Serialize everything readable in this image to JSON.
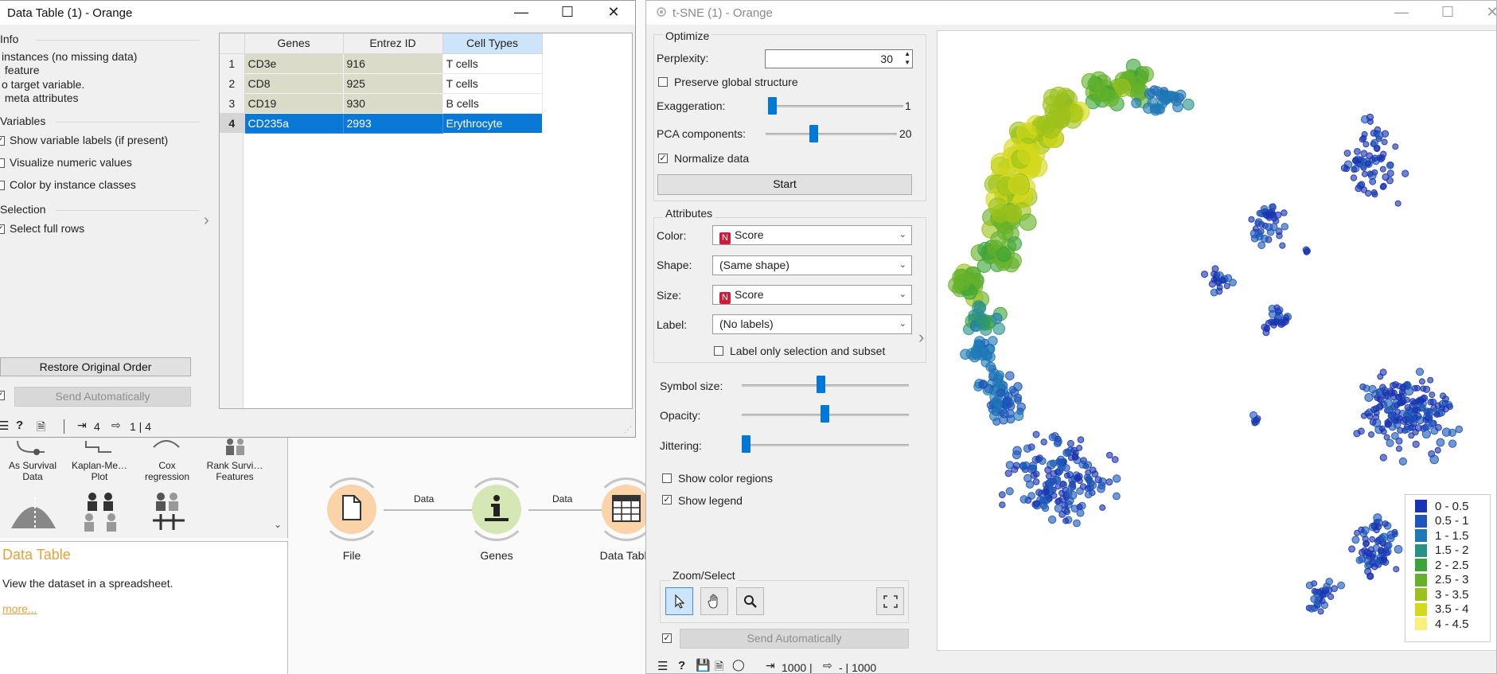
{
  "data_table_window": {
    "title": "Data Table (1) - Orange",
    "info": {
      "heading": "Info",
      "lines": [
        "instances (no missing data)",
        " feature",
        "o target variable.",
        " meta attributes"
      ]
    },
    "variables": {
      "heading": "Variables",
      "show_labels": "Show variable labels (if present)",
      "visualize": "Visualize numeric values",
      "color_by": "Color by instance classes"
    },
    "selection": {
      "heading": "Selection",
      "select_rows": "Select full rows"
    },
    "restore_button": "Restore Original Order",
    "send_button": "Send Automatically",
    "status": {
      "in_count": "4",
      "out_count": "1 | 4"
    },
    "table": {
      "headers": [
        "Genes",
        "Entrez ID",
        "Cell Types"
      ],
      "rows": [
        {
          "num": "1",
          "cells": [
            "CD3e",
            "916",
            "T cells"
          ]
        },
        {
          "num": "2",
          "cells": [
            "CD8",
            "925",
            "T cells"
          ]
        },
        {
          "num": "3",
          "cells": [
            "CD19",
            "930",
            "B cells"
          ]
        },
        {
          "num": "4",
          "cells": [
            "CD235a",
            "2993",
            "Erythrocyte"
          ]
        }
      ],
      "selected_row": 4
    }
  },
  "canvas": {
    "toolbox": [
      {
        "label": "As Survival\nData",
        "icon": "survival-data-icon"
      },
      {
        "label": "Kaplan-Me…\nPlot",
        "icon": "kaplan-meier-icon"
      },
      {
        "label": "Cox\nregression",
        "icon": "cox-regression-icon"
      },
      {
        "label": "Rank Survi…\nFeatures",
        "icon": "rank-features-icon"
      }
    ],
    "help": {
      "title": "Data Table",
      "description": "View the dataset in a spreadsheet.",
      "more": "more..."
    },
    "nodes": [
      {
        "label": "File",
        "icon": "file-icon",
        "color": "#fbd3a8"
      },
      {
        "label": "Genes",
        "icon": "info-icon",
        "color": "#d6e7b6"
      },
      {
        "label": "Data Table",
        "icon": "table-icon",
        "color": "#fbd3a8"
      }
    ],
    "links": [
      "Data",
      "Data"
    ]
  },
  "tsne_window": {
    "title": "t-SNE (1) - Orange",
    "optimize": {
      "heading": "Optimize",
      "perplexity_label": "Perplexity:",
      "perplexity_value": "30",
      "preserve_global": "Preserve global structure",
      "exaggeration_label": "Exaggeration:",
      "exaggeration_value": "1",
      "exaggeration_level": 0.02,
      "pca_label": "PCA components:",
      "pca_value": "20",
      "pca_level": 0.38,
      "normalize": "Normalize data",
      "start_button": "Start"
    },
    "attributes": {
      "heading": "Attributes",
      "color_label": "Color:",
      "color_value": "Score",
      "color_badge": "N",
      "shape_label": "Shape:",
      "shape_value": "(Same shape)",
      "size_label": "Size:",
      "size_value": "Score",
      "size_badge": "N",
      "label_label": "Label:",
      "label_value": "(No labels)",
      "label_only": "Label only selection and subset"
    },
    "sliders": {
      "symbol_size_label": "Symbol size:",
      "symbol_size_level": 0.47,
      "opacity_label": "Opacity:",
      "opacity_level": 0.51,
      "jittering_label": "Jittering:",
      "jittering_level": 0.0
    },
    "show_color_regions": "Show color regions",
    "show_legend": "Show legend",
    "zoom_select": {
      "heading": "Zoom/Select"
    },
    "send_button": "Send Automatically",
    "status": {
      "in_count": "1000 |",
      "out_count": "- | 1000"
    },
    "legend": [
      {
        "label": "0 - 0.5",
        "color": "#1a33b0"
      },
      {
        "label": "0.5 - 1",
        "color": "#1d57b8"
      },
      {
        "label": "1 - 1.5",
        "color": "#1f79b6"
      },
      {
        "label": "1.5 - 2",
        "color": "#2a9188"
      },
      {
        "label": "2 - 2.5",
        "color": "#3ea43a"
      },
      {
        "label": "2.5 - 3",
        "color": "#66b12a"
      },
      {
        "label": "3 - 3.5",
        "color": "#9cc11c"
      },
      {
        "label": "3.5 - 4",
        "color": "#d3d91c"
      },
      {
        "label": "4 - 4.5",
        "color": "#f7f07a"
      }
    ]
  }
}
